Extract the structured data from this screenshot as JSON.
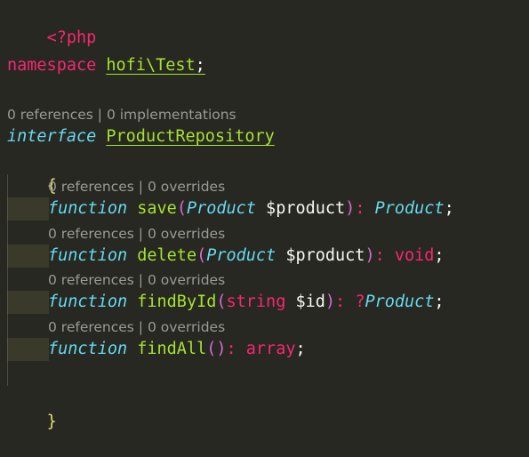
{
  "editor": {
    "open_tag": "<?php",
    "namespace_kw": "namespace",
    "namespace_name": "hofi\\Test",
    "namespace_semi": ";",
    "interface_meta": "0 references | 0 implementations",
    "interface_kw": "interface",
    "interface_name": "ProductRepository",
    "open_brace": "{",
    "close_brace": "}",
    "methods": [
      {
        "meta": "0 references | 0 overrides",
        "fn_kw": "function",
        "name": "save",
        "open_paren": "(",
        "param_type": "Product",
        "param_var": " $product",
        "close_paren": ")",
        "colon": ":",
        "return_type": "Product",
        "semi": ";"
      },
      {
        "meta": "0 references | 0 overrides",
        "fn_kw": "function",
        "name": "delete",
        "open_paren": "(",
        "param_type": "Product",
        "param_var": " $product",
        "close_paren": ")",
        "colon": ":",
        "return_type": "void",
        "semi": ";"
      },
      {
        "meta": "0 references | 0 overrides",
        "fn_kw": "function",
        "name": "findById",
        "open_paren": "(",
        "param_type": "string",
        "param_var": " $id",
        "close_paren": ")",
        "colon": ":",
        "return_nullable": "?",
        "return_type": "Product",
        "semi": ";"
      },
      {
        "meta": "0 references | 0 overrides",
        "fn_kw": "function",
        "name": "findAll",
        "open_paren": "(",
        "close_paren": ")",
        "colon": ":",
        "return_type": "array",
        "semi": ";"
      }
    ]
  },
  "colors": {
    "background": "#272822",
    "keyword": "#f92672",
    "function_name": "#a6e22e",
    "storage": "#66d9ef",
    "brace": "#e6db74",
    "paren": "#d46ad4",
    "codelens": "#9a9a96"
  }
}
